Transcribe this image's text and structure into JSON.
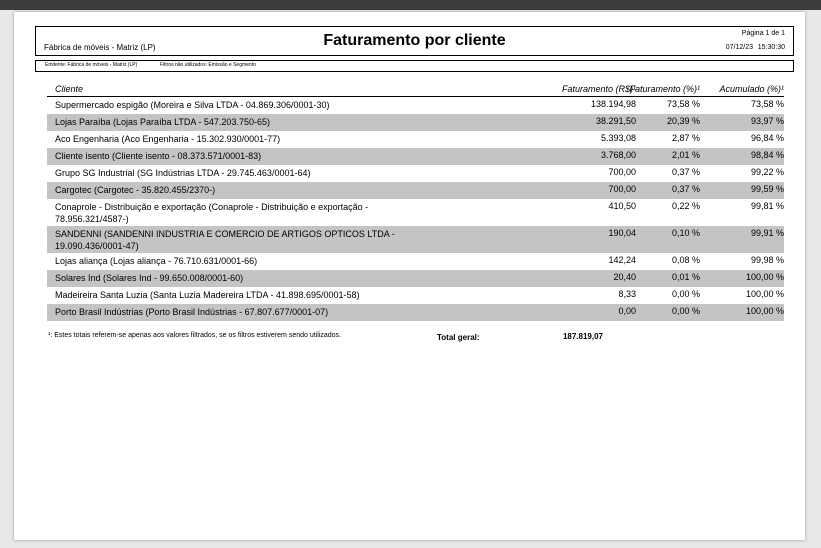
{
  "header": {
    "company": "Fábrica de móveis - Matriz (LP)",
    "title": "Faturamento por cliente",
    "page_label": "Página 1 de 1",
    "date": "07/12/23",
    "time": "15:30:30"
  },
  "filters": {
    "emitter": "Emitente: Fábrica de móveis - Matriz (LP)",
    "unused": "Filtros não utilizados: Emissão e Segmento"
  },
  "table": {
    "columns": {
      "client": "Cliente",
      "revenue": "Faturamento (R$)¹",
      "percent": "Faturamento (%)¹",
      "accumulated": "Acumulado (%)¹"
    },
    "rows": [
      {
        "client": "Supermercado espigão (Moreira e Silva LTDA - 04.869.306/0001-30)",
        "revenue": "138.194,98",
        "percent": "73,58 %",
        "accumulated": "73,58 %"
      },
      {
        "client": "Lojas Paraíba (Lojas Paraíba LTDA - 547.203.750-65)",
        "revenue": "38.291,50",
        "percent": "20,39 %",
        "accumulated": "93,97 %"
      },
      {
        "client": "Aco Engenharia (Aco Engenharia - 15.302.930/0001-77)",
        "revenue": "5.393,08",
        "percent": "2,87 %",
        "accumulated": "96,84 %"
      },
      {
        "client": "Cliente isento (Cliente isento - 08.373.571/0001-83)",
        "revenue": "3.768,00",
        "percent": "2,01 %",
        "accumulated": "98,84 %"
      },
      {
        "client": "Grupo SG Industrial (SG Indústrias LTDA - 29.745.463/0001-64)",
        "revenue": "700,00",
        "percent": "0,37 %",
        "accumulated": "99,22 %"
      },
      {
        "client": "Cargotec (Cargotec - 35.820.455/2370-)",
        "revenue": "700,00",
        "percent": "0,37 %",
        "accumulated": "99,59 %"
      },
      {
        "client": "Conaprole - Distribuição e exportação (Conaprole - Distribuição e exportação - 78.956.321/4587-)",
        "revenue": "410,50",
        "percent": "0,22 %",
        "accumulated": "99,81 %"
      },
      {
        "client": "SANDENNI (SANDENNI INDUSTRIA E COMERCIO DE ARTIGOS OPTICOS LTDA - 19.090.436/0001-47)",
        "revenue": "190,04",
        "percent": "0,10 %",
        "accumulated": "99,91 %"
      },
      {
        "client": "Lojas aliança (Lojas aliança - 76.710.631/0001-66)",
        "revenue": "142,24",
        "percent": "0,08 %",
        "accumulated": "99,98 %"
      },
      {
        "client": "Solares Ind (Solares Ind - 99.650.008/0001-60)",
        "revenue": "20,40",
        "percent": "0,01 %",
        "accumulated": "100,00 %"
      },
      {
        "client": "Madeireira Santa Luzia (Santa Luzia Madereira LTDA - 41.898.695/0001-58)",
        "revenue": "8,33",
        "percent": "0,00 %",
        "accumulated": "100,00 %"
      },
      {
        "client": "Porto Brasil Indústrias (Porto Brasil Indústrias - 67.807.677/0001-07)",
        "revenue": "0,00",
        "percent": "0,00 %",
        "accumulated": "100,00 %"
      }
    ]
  },
  "footer": {
    "footnote": "¹: Estes totais referem-se apenas aos valores filtrados, se os filtros estiverem sendo utilizados.",
    "total_label": "Total geral:",
    "total_value": "187.819,07"
  }
}
